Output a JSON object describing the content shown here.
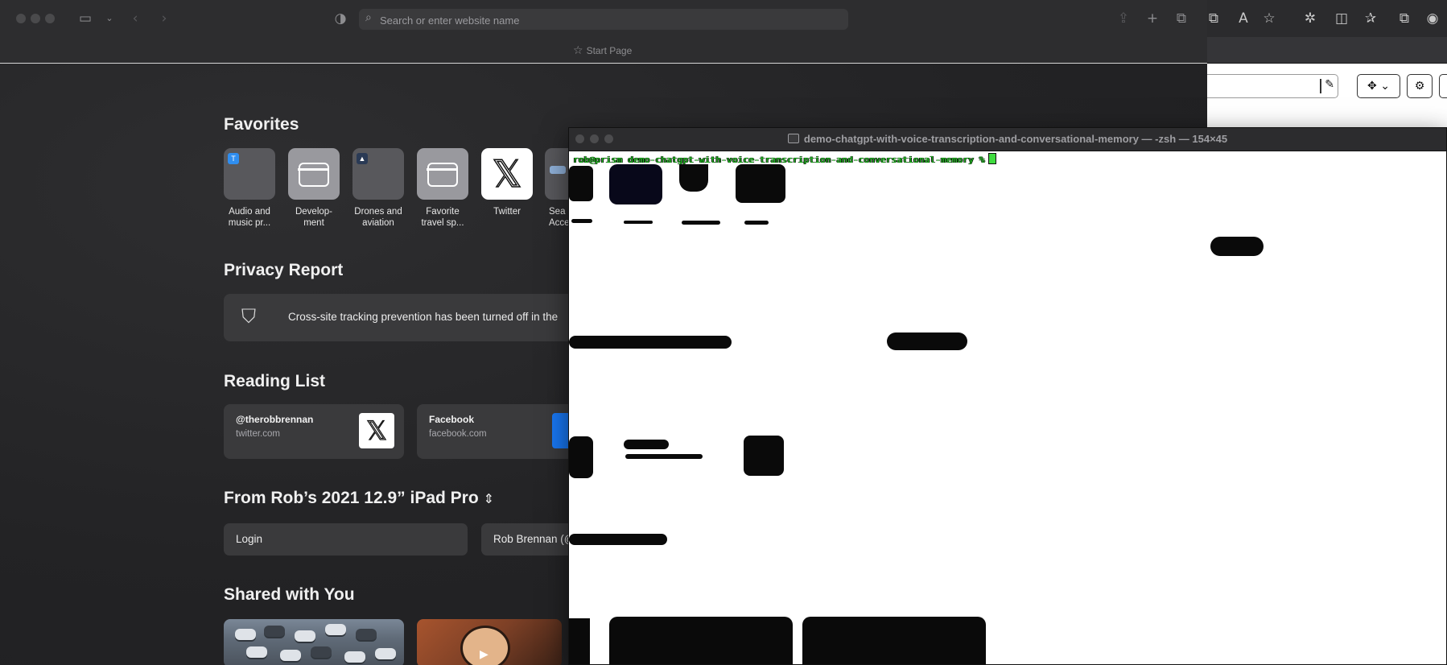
{
  "browser": {
    "search_placeholder": "Search or enter website name",
    "tab_label": "Start Page",
    "icons": {
      "sidebar": "sidebar-icon",
      "back": "back-icon",
      "forward": "forward-icon",
      "extension": "extension-icon",
      "share": "share-icon",
      "new_tab": "plus-icon",
      "tabs_overview": "tabs-icon"
    }
  },
  "favorites": {
    "title": "Favorites",
    "items": [
      {
        "label_line1": "Audio and",
        "label_line2": "music pr..."
      },
      {
        "label_line1": "Develop-",
        "label_line2": "ment"
      },
      {
        "label_line1": "Drones and",
        "label_line2": "aviation"
      },
      {
        "label_line1": "Favorite",
        "label_line2": "travel sp..."
      },
      {
        "label_line1": "Twitter",
        "label_line2": ""
      },
      {
        "label_line1": "Sea",
        "label_line2": "Acce"
      }
    ]
  },
  "privacy": {
    "title": "Privacy Report",
    "message": "Cross-site tracking prevention has been turned off in the"
  },
  "reading_list": {
    "title": "Reading List",
    "items": [
      {
        "title": "@therobbrennan",
        "url": "twitter.com"
      },
      {
        "title": "Facebook",
        "url": "facebook.com"
      }
    ]
  },
  "devices": {
    "title": "From Rob’s 2021 12.9” iPad Pro",
    "tabs": [
      "Login",
      "Rob Brennan (@"
    ]
  },
  "shared": {
    "title": "Shared with You"
  },
  "terminal": {
    "title": "demo-chatgpt-with-voice-transcription-and-conversational-memory — -zsh — 154×45",
    "prompt": "rob@prism demo-chatgpt-with-voice-transcription-and-conversational-memory %"
  },
  "colors": {
    "browser_bg": "#232325",
    "toolbar": "#2d2d2f",
    "card": "#3a3a3c",
    "terminal_bg": "#ffffff",
    "prompt_green": "#22c522"
  }
}
